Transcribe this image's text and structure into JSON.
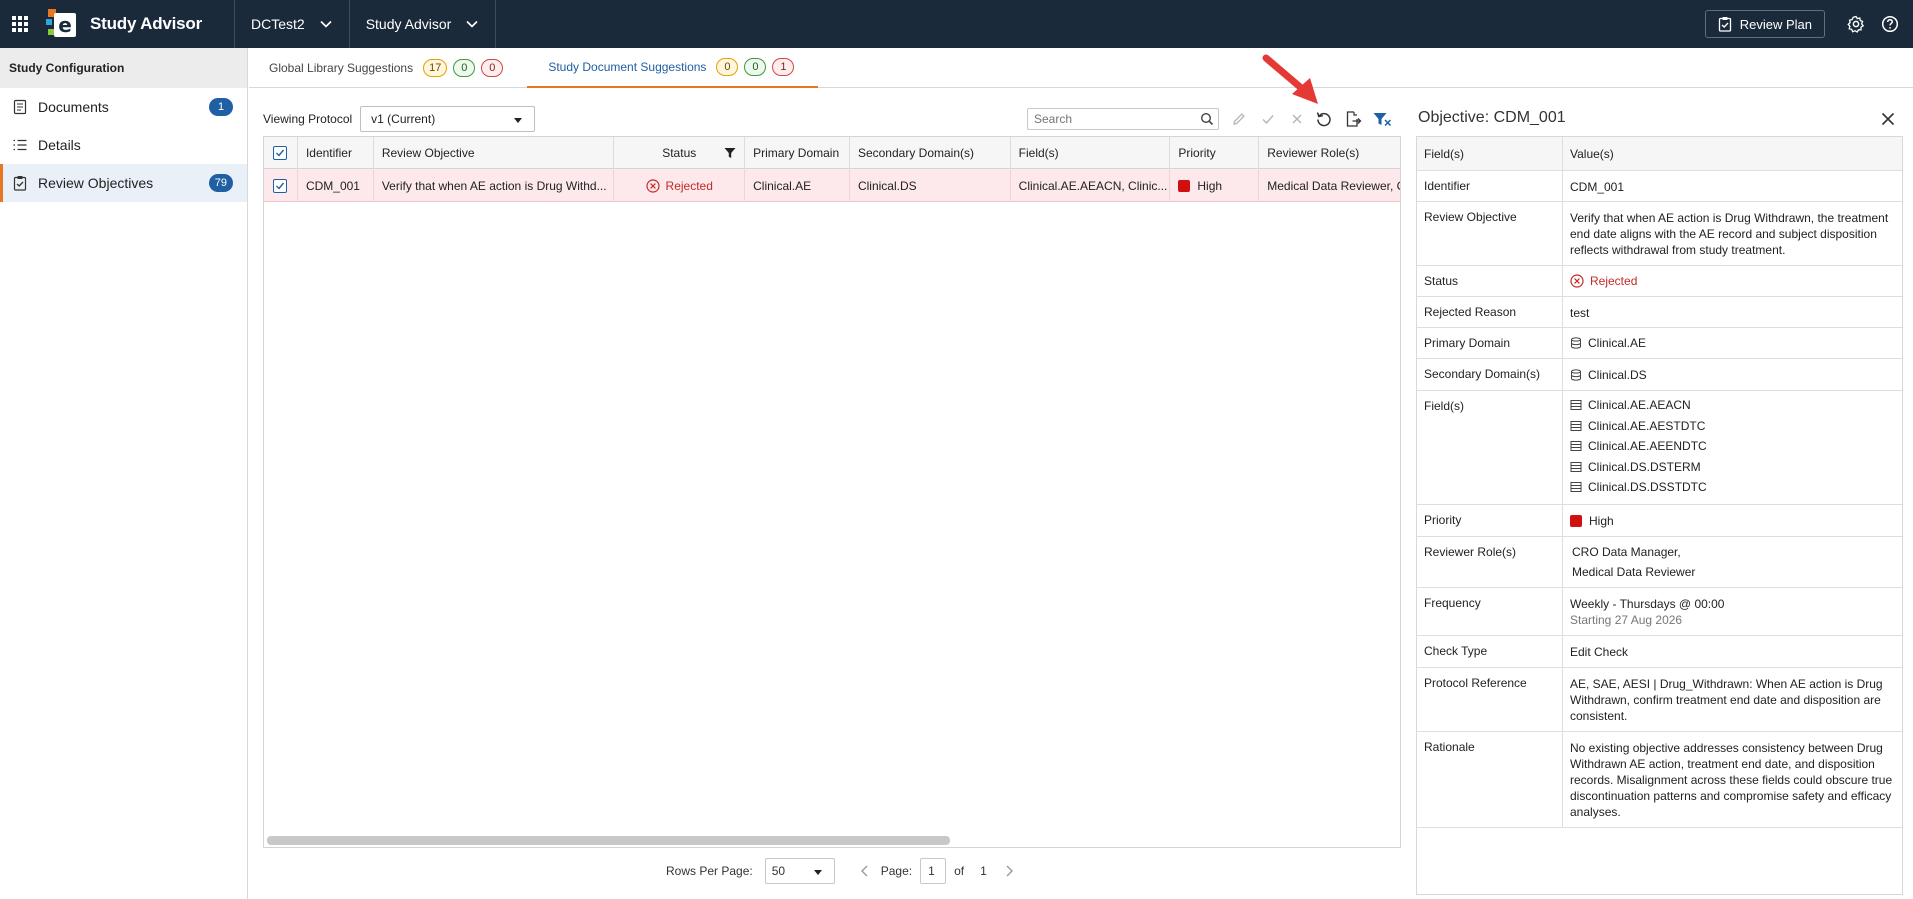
{
  "topbar": {
    "app_title": "Study Advisor",
    "study_dropdown": "DCTest2",
    "module_dropdown": "Study Advisor",
    "review_plan_label": "Review Plan"
  },
  "sidebar": {
    "header": "Study Configuration",
    "items": [
      {
        "label": "Documents",
        "badge": "1"
      },
      {
        "label": "Details",
        "badge": ""
      },
      {
        "label": "Review Objectives",
        "badge": "79"
      }
    ]
  },
  "tabs": [
    {
      "label": "Global Library Suggestions",
      "counts": [
        "17",
        "0",
        "0"
      ]
    },
    {
      "label": "Study Document Suggestions",
      "counts": [
        "0",
        "0",
        "1"
      ]
    }
  ],
  "toolbar": {
    "viewing_protocol_label": "Viewing Protocol",
    "viewing_protocol_value": "v1 (Current)",
    "search_placeholder": "Search"
  },
  "table": {
    "columns": [
      "Identifier",
      "Review Objective",
      "Status",
      "Primary Domain",
      "Secondary Domain(s)",
      "Field(s)",
      "Priority",
      "Reviewer Role(s)"
    ],
    "rows": [
      {
        "identifier": "CDM_001",
        "objective": "Verify that when AE action is Drug Withd...",
        "status": "Rejected",
        "primary_domain": "Clinical.AE",
        "secondary_domain": "Clinical.DS",
        "fields": "Clinical.AE.AEACN, Clinic...",
        "priority": "High",
        "reviewer_roles": "Medical Data Reviewer, CR"
      }
    ]
  },
  "pager": {
    "rows_per_page_label": "Rows Per Page:",
    "rows_per_page_value": "50",
    "page_label": "Page:",
    "page_value": "1",
    "of_label": "of",
    "total_pages": "1"
  },
  "detail": {
    "title": "Objective: CDM_001",
    "header_key": "Field(s)",
    "header_value": "Value(s)",
    "identifier_key": "Identifier",
    "identifier": "CDM_001",
    "objective_key": "Review Objective",
    "objective": "Verify that when AE action is Drug Withdrawn, the treatment end date aligns with the AE record and subject disposition reflects withdrawal from study treatment.",
    "status_key": "Status",
    "status": "Rejected",
    "rejected_reason_key": "Rejected Reason",
    "rejected_reason": "test",
    "primary_domain_key": "Primary Domain",
    "primary_domain": "Clinical.AE",
    "secondary_domain_key": "Secondary Domain(s)",
    "secondary_domain": "Clinical.DS",
    "fields_key": "Field(s)",
    "fields": [
      "Clinical.AE.AEACN",
      "Clinical.AE.AESTDTC",
      "Clinical.AE.AEENDTC",
      "Clinical.DS.DSTERM",
      "Clinical.DS.DSSTDTC"
    ],
    "priority_key": "Priority",
    "priority": "High",
    "reviewer_roles_key": "Reviewer Role(s)",
    "reviewer_roles": [
      "CRO Data Manager,",
      "Medical Data Reviewer"
    ],
    "frequency_key": "Frequency",
    "frequency": "Weekly - Thursdays @ 00:00",
    "frequency_start": "Starting 27 Aug 2026",
    "check_type_key": "Check Type",
    "check_type": "Edit Check",
    "protocol_reference_key": "Protocol Reference",
    "protocol_reference": "AE, SAE, AESI | Drug_Withdrawn: When AE action is Drug Withdrawn, confirm treatment end date and disposition are consistent.",
    "rationale_key": "Rationale",
    "rationale": "No existing objective addresses consistency between Drug Withdrawn AE action, treatment end date, and disposition records. Misalignment across these fields could obscure true discontinuation patterns and compromise safety and efficacy analyses."
  },
  "colors": {
    "topbar": "#1b2a3a",
    "accent": "#1f5fa3",
    "tab_underline": "#e87722",
    "rejected": "#c62828",
    "priority_high": "#d20f0f",
    "row_highlight": "#fde9eb"
  }
}
